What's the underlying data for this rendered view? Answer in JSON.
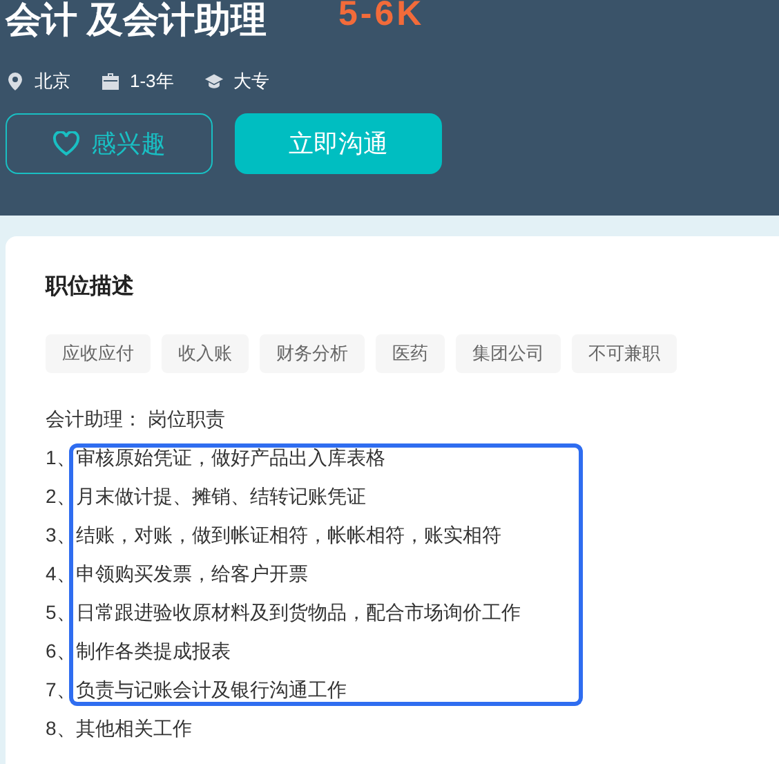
{
  "job": {
    "title": "会计 及会计助理",
    "salary": "5-6K",
    "meta": [
      {
        "kind": "location",
        "text": "北京"
      },
      {
        "kind": "experience",
        "text": "1-3年"
      },
      {
        "kind": "education",
        "text": "大专"
      }
    ],
    "buttons": [
      {
        "kind": "outline",
        "label": "感兴趣"
      },
      {
        "kind": "primary",
        "label": "立即沟通"
      }
    ]
  },
  "description": {
    "heading": "职位描述",
    "tags": [
      "应收应付",
      "收入账",
      "财务分析",
      "医药",
      "集团公司",
      "不可兼职"
    ],
    "intro": "会计助理：  岗位职责",
    "lines": [
      {
        "number": "1、",
        "text": "审核原始凭证，做好产品出入库表格",
        "highlighted": true
      },
      {
        "number": "2、",
        "text": "月末做计提、摊销、结转记账凭证",
        "highlighted": true
      },
      {
        "number": "3、",
        "text": "结账，对账，做到帐证相符，帐帐相符，账实相符",
        "highlighted": true
      },
      {
        "number": "4、",
        "text": "申领购买发票，给客户开票",
        "highlighted": true
      },
      {
        "number": "5、",
        "text": "日常跟进验收原材料及到货物品，配合市场询价工作",
        "highlighted": true
      },
      {
        "number": "6、",
        "text": "制作各类提成报表",
        "highlighted": true
      },
      {
        "number": "7、",
        "text": "负责与记账会计及银行沟通工作",
        "highlighted": true
      },
      {
        "number": "8、",
        "text": "其他相关工作",
        "highlighted": false
      }
    ]
  }
}
